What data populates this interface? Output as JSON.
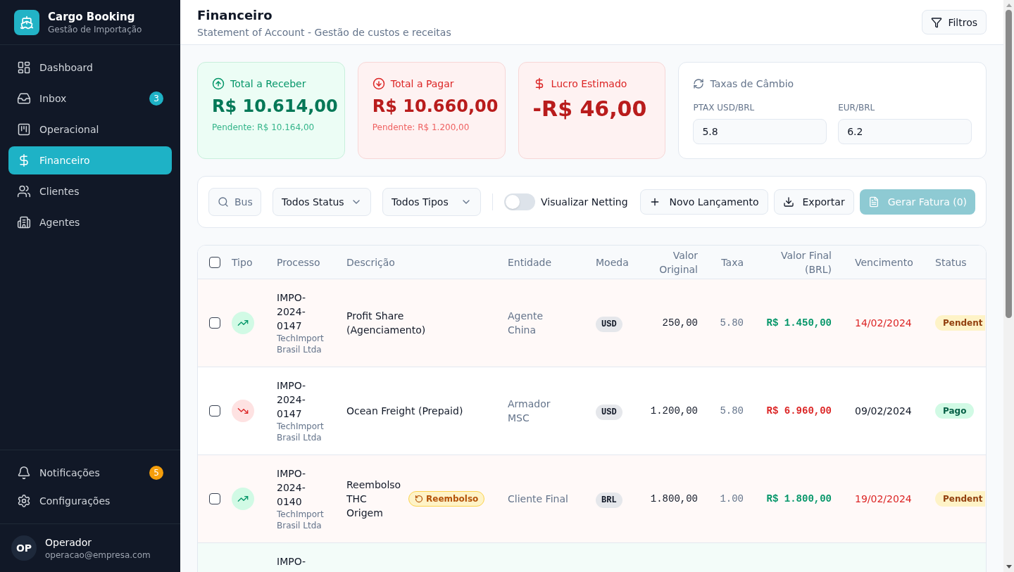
{
  "sidebar": {
    "brand": {
      "title": "Cargo Booking",
      "subtitle": "Gestão de Importação"
    },
    "nav": [
      {
        "label": "Dashboard",
        "selected": false
      },
      {
        "label": "Inbox",
        "badge": "3",
        "selected": false
      },
      {
        "label": "Operacional",
        "selected": false
      },
      {
        "label": "Financeiro",
        "selected": true
      },
      {
        "label": "Clientes",
        "selected": false
      },
      {
        "label": "Agentes",
        "selected": false
      }
    ],
    "footer_nav": [
      {
        "label": "Notificações",
        "badge": "5",
        "selected": false
      },
      {
        "label": "Configurações",
        "selected": false
      }
    ],
    "user": {
      "initials": "OP",
      "name": "Operador",
      "email": "operacao@empresa.com"
    }
  },
  "header": {
    "title": "Financeiro",
    "subtitle": "Statement of Account - Gestão de custos e receitas",
    "filter_button": "Filtros"
  },
  "summary_cards": [
    {
      "kind": "receivable",
      "title": "Total a Receber",
      "value": "R$ 10.614,00",
      "note": "Pendente: R$ 10.164,00"
    },
    {
      "kind": "payable",
      "title": "Total a Pagar",
      "value": "R$ 10.660,00",
      "note": "Pendente: R$ 1.200,00"
    },
    {
      "kind": "profit",
      "title": "Lucro Estimado",
      "value": "-R$ 46,00"
    }
  ],
  "exchange_rates": {
    "title": "Taxas de Câmbio",
    "fields": [
      {
        "label": "PTAX USD/BRL",
        "value": "5.8"
      },
      {
        "label": "EUR/BRL",
        "value": "6.2"
      }
    ]
  },
  "toolbar": {
    "search": {
      "placeholder": "Bus"
    },
    "selects": [
      {
        "value": "Todos Status"
      },
      {
        "value": "Todos Tipos"
      }
    ],
    "netting_toggle": {
      "label": "Visualizar Netting",
      "on": false
    },
    "buttons": [
      {
        "kind": "new",
        "label": "Novo Lançamento",
        "disabled": false
      },
      {
        "kind": "export",
        "label": "Exportar",
        "disabled": false
      },
      {
        "kind": "invoice",
        "label": "Gerar Fatura (0)",
        "disabled": true
      }
    ]
  },
  "table": {
    "all_checked": false,
    "columns": [
      "Tipo",
      "Processo",
      "Descrição",
      "Entidade",
      "Moeda",
      "Valor Original",
      "Taxa",
      "Valor Final (BRL)",
      "Vencimento",
      "Status"
    ],
    "rows": [
      {
        "color": "#fff9f8",
        "checked": false,
        "kind": "receivable",
        "process": "IMPO-2024-0147",
        "client": "TechImport Brasil Ltda",
        "description": "Profit Share (Agenciamento)",
        "entity": "Agente China",
        "currency": "USD",
        "original_value": "250,00",
        "rate": "5.80",
        "final_value": "R$ 1.450,00",
        "due_date": "14/02/2024",
        "overdue": true,
        "status": {
          "kind": "pending",
          "label": "Pendent"
        }
      },
      {
        "color": "#ffffff",
        "checked": false,
        "kind": "payable",
        "process": "IMPO-2024-0147",
        "client": "TechImport Brasil Ltda",
        "description": "Ocean Freight (Prepaid)",
        "entity": "Armador MSC",
        "currency": "USD",
        "original_value": "1.200,00",
        "rate": "5.80",
        "final_value": "R$ 6.960,00",
        "due_date": "09/02/2024",
        "overdue": false,
        "status": {
          "kind": "paid",
          "label": "Pago"
        }
      },
      {
        "color": "#fff9f8",
        "checked": false,
        "kind": "receivable",
        "process": "IMPO-2024-0140",
        "client": "TechImport Brasil Ltda",
        "description": "Reembolso THC Origem",
        "tag": "Reembolso",
        "entity": "Cliente Final",
        "currency": "BRL",
        "original_value": "1.800,00",
        "rate": "1.00",
        "final_value": "R$ 1.800,00",
        "due_date": "19/02/2024",
        "overdue": true,
        "status": {
          "kind": "pending",
          "label": "Pendent"
        }
      },
      {
        "color": "#f3fcf9",
        "process": "IMPO-"
      }
    ]
  }
}
